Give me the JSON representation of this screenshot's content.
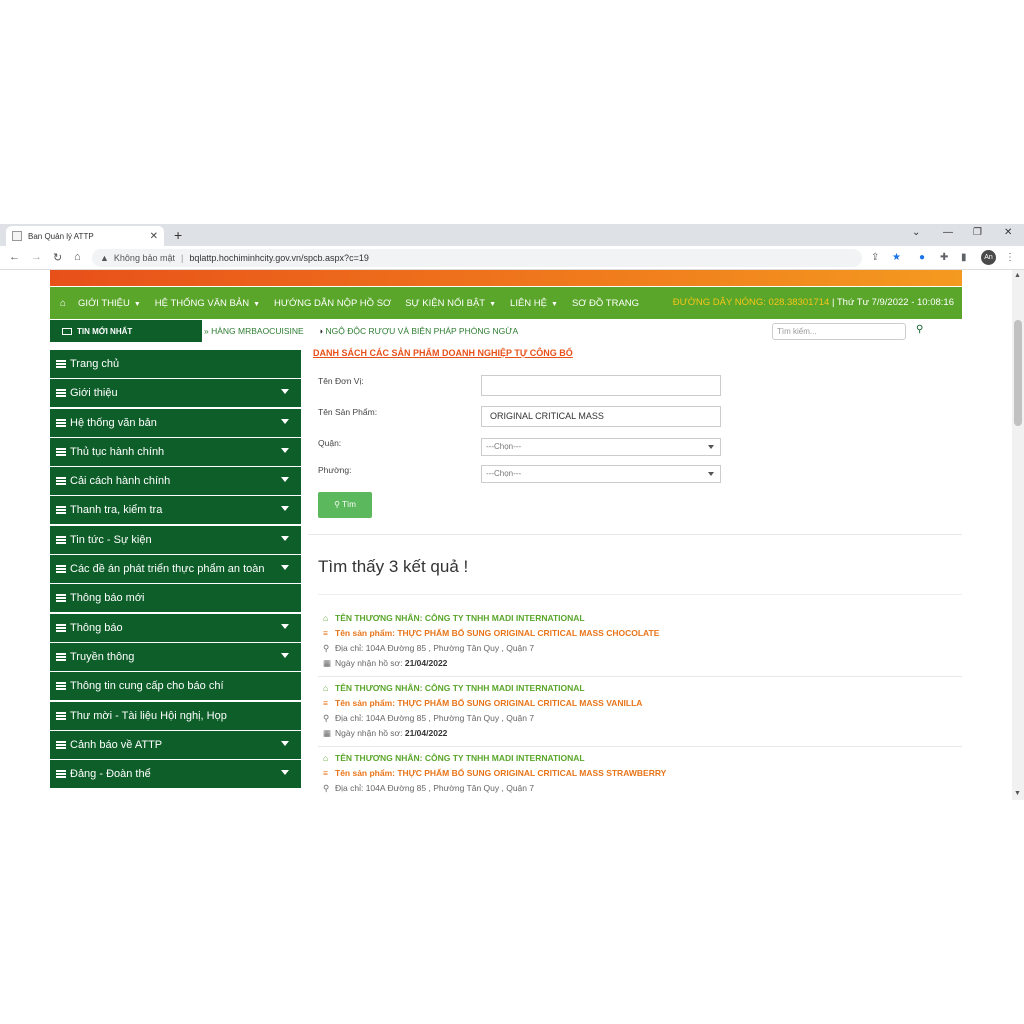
{
  "browser": {
    "tab_title": "Ban Quản lý ATTP",
    "security_label": "Không bảo mật",
    "url": "bqlattp.hochiminhcity.gov.vn/spcb.aspx?c=19",
    "avatar": "An"
  },
  "nav": {
    "items": [
      {
        "label": "GIỚI THIỆU",
        "dropdown": true
      },
      {
        "label": "HỆ THỐNG VĂN BẢN",
        "dropdown": true
      },
      {
        "label": "HƯỚNG DẪN NỘP HỒ SƠ",
        "dropdown": false
      },
      {
        "label": "SỰ KIỆN NỔI BẬT",
        "dropdown": true
      },
      {
        "label": "LIÊN HỆ",
        "dropdown": true
      },
      {
        "label": "SƠ ĐỒ TRANG",
        "dropdown": false
      }
    ],
    "hotline_label": "ĐƯỜNG DÂY NÓNG: 028.38301714",
    "datetime": "| Thứ Tư 7/9/2022 - 10:08:16"
  },
  "newsbar": {
    "badge": "TIN MỚI NHẤT",
    "ticker1": "» HÀNG MRBAOCUISINE",
    "ticker2": "NGỘ ĐỘC RƯỢU VÀ BIỆN PHÁP PHÒNG NGỪA",
    "search_placeholder": "Tìm kiếm..."
  },
  "sidebar": {
    "items": [
      {
        "label": "Trang chủ",
        "dropdown": false
      },
      {
        "label": "Giới thiệu",
        "dropdown": true
      },
      {
        "label": "Hệ thống văn bản",
        "dropdown": true
      },
      {
        "label": "Thủ tục hành chính",
        "dropdown": true
      },
      {
        "label": "Cải cách hành chính",
        "dropdown": true
      },
      {
        "label": "Thanh tra, kiểm tra",
        "dropdown": true
      },
      {
        "label": "Tin tức - Sự kiện",
        "dropdown": true
      },
      {
        "label": "Các đề án phát triển thực phẩm an toàn",
        "dropdown": true
      },
      {
        "label": "Thông báo mới",
        "dropdown": false
      },
      {
        "label": "Thông báo",
        "dropdown": true
      },
      {
        "label": "Truyền thông",
        "dropdown": true
      },
      {
        "label": "Thông tin cung cấp cho báo chí",
        "dropdown": false
      },
      {
        "label": "Thư mời - Tài liệu Hội nghị, Họp",
        "dropdown": false
      },
      {
        "label": "Cảnh báo về ATTP",
        "dropdown": true
      },
      {
        "label": "Đảng - Đoàn thể",
        "dropdown": true
      }
    ]
  },
  "form": {
    "title": "DANH SÁCH CÁC SẢN PHẨM DOANH NGHIỆP TỰ CÔNG BỐ",
    "unit_label": "Tên Đơn Vị:",
    "unit_value": "",
    "product_label": "Tên Sản Phẩm:",
    "product_value": "ORIGINAL CRITICAL MASS",
    "district_label": "Quận:",
    "district_value": "---Chọn---",
    "ward_label": "Phường:",
    "ward_value": "---Chọn---",
    "search_button": "Tìm"
  },
  "results": {
    "count_text": "Tìm thấy 3 kết quả !",
    "items": [
      {
        "company": "TÊN THƯƠNG NHÂN: CÔNG TY TNHH MADI INTERNATIONAL",
        "product": "Tên sản phẩm: THỰC PHẨM BỔ SUNG ORIGINAL CRITICAL MASS CHOCOLATE",
        "address": "Địa chỉ: 104A Đường 85 , Phường Tân Quy , Quận 7",
        "date_label": "Ngày nhận hồ sơ:",
        "date": "21/04/2022"
      },
      {
        "company": "TÊN THƯƠNG NHÂN: CÔNG TY TNHH MADI INTERNATIONAL",
        "product": "Tên sản phẩm: THỰC PHẨM BỔ SUNG ORIGINAL CRITICAL MASS VANILLA",
        "address": "Địa chỉ: 104A Đường 85 , Phường Tân Quy , Quận 7",
        "date_label": "Ngày nhận hồ sơ:",
        "date": "21/04/2022"
      },
      {
        "company": "TÊN THƯƠNG NHÂN: CÔNG TY TNHH MADI INTERNATIONAL",
        "product": "Tên sản phẩm: THỰC PHẨM BỔ SUNG ORIGINAL CRITICAL MASS STRAWBERRY",
        "address": "Địa chỉ: 104A Đường 85 , Phường Tân Quy , Quận 7",
        "date_label": "",
        "date": ""
      }
    ]
  },
  "colors": {
    "nav_green": "#5aa62a",
    "sidebar_green": "#0e5e2a",
    "accent_orange": "#e8501a",
    "button_green": "#5cb85c"
  }
}
